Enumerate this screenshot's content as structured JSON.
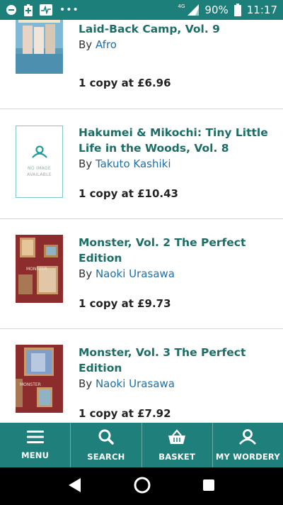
{
  "status_bar": {
    "network": "4G",
    "battery": "90%",
    "time": "11:17",
    "icons": [
      "do-not-disturb-icon",
      "battery-saver-icon",
      "activity-icon",
      "more-dots-icon",
      "signal-icon",
      "battery-icon"
    ],
    "dots": "•••"
  },
  "books": [
    {
      "title": "Laid-Back Camp, Vol. 9",
      "by": "By",
      "author": "Afro",
      "price": "1 copy at £6.96",
      "cover": "cover-image"
    },
    {
      "title": "Hakumei & Mikochi: Tiny Little Life in the Woods, Vol. 8",
      "by": "By",
      "author": "Takuto Kashiki",
      "price": "1 copy at £10.43",
      "cover": "no-image",
      "no_image_text": "NO IMAGE AVAILABLE"
    },
    {
      "title": "Monster, Vol. 2 The Perfect Edition",
      "by": "By",
      "author": "Naoki Urasawa",
      "price": "1 copy at £9.73",
      "cover": "cover-image"
    },
    {
      "title": "Monster, Vol. 3 The Perfect Edition",
      "by": "By",
      "author": "Naoki Urasawa",
      "price": "1 copy at £7.92",
      "cover": "cover-image"
    }
  ],
  "bottom_nav": {
    "menu": "MENU",
    "search": "SEARCH",
    "basket": "BASKET",
    "my_wordery": "MY WORDERY"
  },
  "colors": {
    "brand_teal": "#1f7f7b",
    "title_teal": "#1c6d66",
    "link_blue": "#1f6fa8"
  }
}
